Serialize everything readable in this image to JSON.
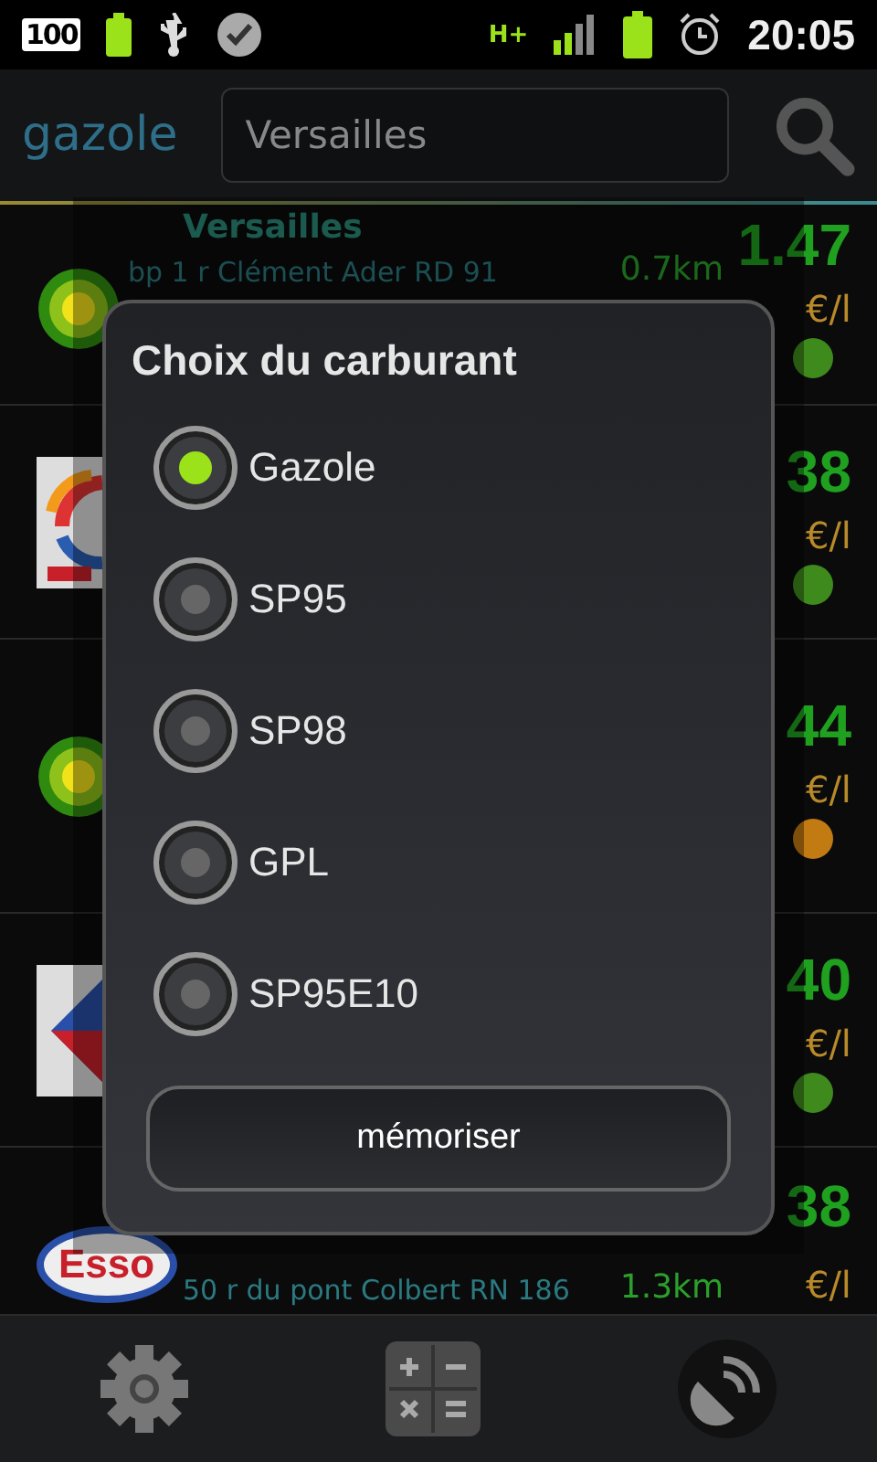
{
  "status_bar": {
    "battery_badge": "100",
    "network": "H+",
    "time": "20:05"
  },
  "header": {
    "title": "gazole",
    "search": {
      "value": "Versailles"
    }
  },
  "stations": [
    {
      "kind": "bp",
      "name": "Versailles",
      "address": "bp 1 r Clément Ader RD 91",
      "distance": "0.7km",
      "price": "1.47",
      "unit": "€/l",
      "color": "#3f8a1c"
    },
    {
      "kind": "total",
      "price": "38",
      "unit": "€/l",
      "color": "#3f8a1c"
    },
    {
      "kind": "bp",
      "price": "44",
      "unit": "€/l",
      "color": "#c27a12"
    },
    {
      "kind": "leader",
      "price": "40",
      "unit": "€/l",
      "color": "#3f8a1c"
    },
    {
      "kind": "esso",
      "logo_text": "Esso",
      "address": "50 r du pont Colbert RN 186",
      "distance": "1.3km",
      "price": "38",
      "unit": "€/l"
    }
  ],
  "dialog": {
    "title": "Choix du carburant",
    "options": [
      {
        "label": "Gazole",
        "selected": true
      },
      {
        "label": "SP95",
        "selected": false
      },
      {
        "label": "SP98",
        "selected": false
      },
      {
        "label": "GPL",
        "selected": false
      },
      {
        "label": "SP95E10",
        "selected": false
      }
    ],
    "button": "mémoriser"
  }
}
